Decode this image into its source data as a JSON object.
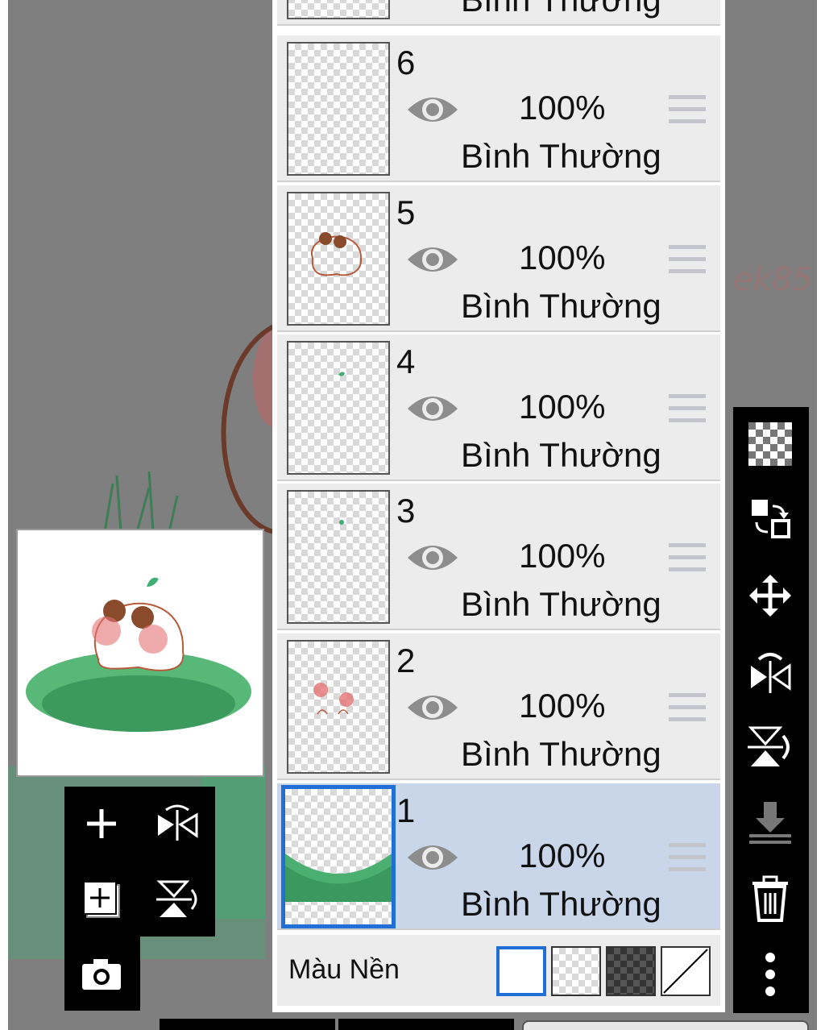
{
  "layers": [
    {
      "number": "",
      "opacity": "",
      "blend_mode": "Bình Thường",
      "visible": true,
      "selected": false
    },
    {
      "number": "6",
      "opacity": "100%",
      "blend_mode": "Bình Thường",
      "visible": true,
      "selected": false
    },
    {
      "number": "5",
      "opacity": "100%",
      "blend_mode": "Bình Thường",
      "visible": true,
      "selected": false
    },
    {
      "number": "4",
      "opacity": "100%",
      "blend_mode": "Bình Thường",
      "visible": true,
      "selected": false
    },
    {
      "number": "3",
      "opacity": "100%",
      "blend_mode": "Bình Thường",
      "visible": true,
      "selected": false
    },
    {
      "number": "2",
      "opacity": "100%",
      "blend_mode": "Bình Thường",
      "visible": true,
      "selected": false
    },
    {
      "number": "1",
      "opacity": "100%",
      "blend_mode": "Bình Thường",
      "visible": true,
      "selected": true
    }
  ],
  "background": {
    "label": "Màu Nền",
    "options": [
      "white-swatch",
      "transparent-swatch",
      "dark-checker-swatch",
      "none-swatch"
    ],
    "selected": "white-swatch"
  },
  "left_toolbar": [
    "add-layer-icon",
    "flip-horizontal-icon",
    "add-copy-layer-icon",
    "flip-vertical-icon",
    "camera-icon"
  ],
  "right_toolbar": [
    "transparency-icon",
    "swap-layer-icon",
    "move-icon",
    "flip-horizontal-icon",
    "flip-vertical-icon",
    "merge-down-icon",
    "trash-icon",
    "more-icon"
  ],
  "colors": {
    "selection": "#1f6fd6",
    "selected_row": "#c9d6ea",
    "canvas_gray": "#7f7f7f",
    "grass": "#3fae72"
  }
}
